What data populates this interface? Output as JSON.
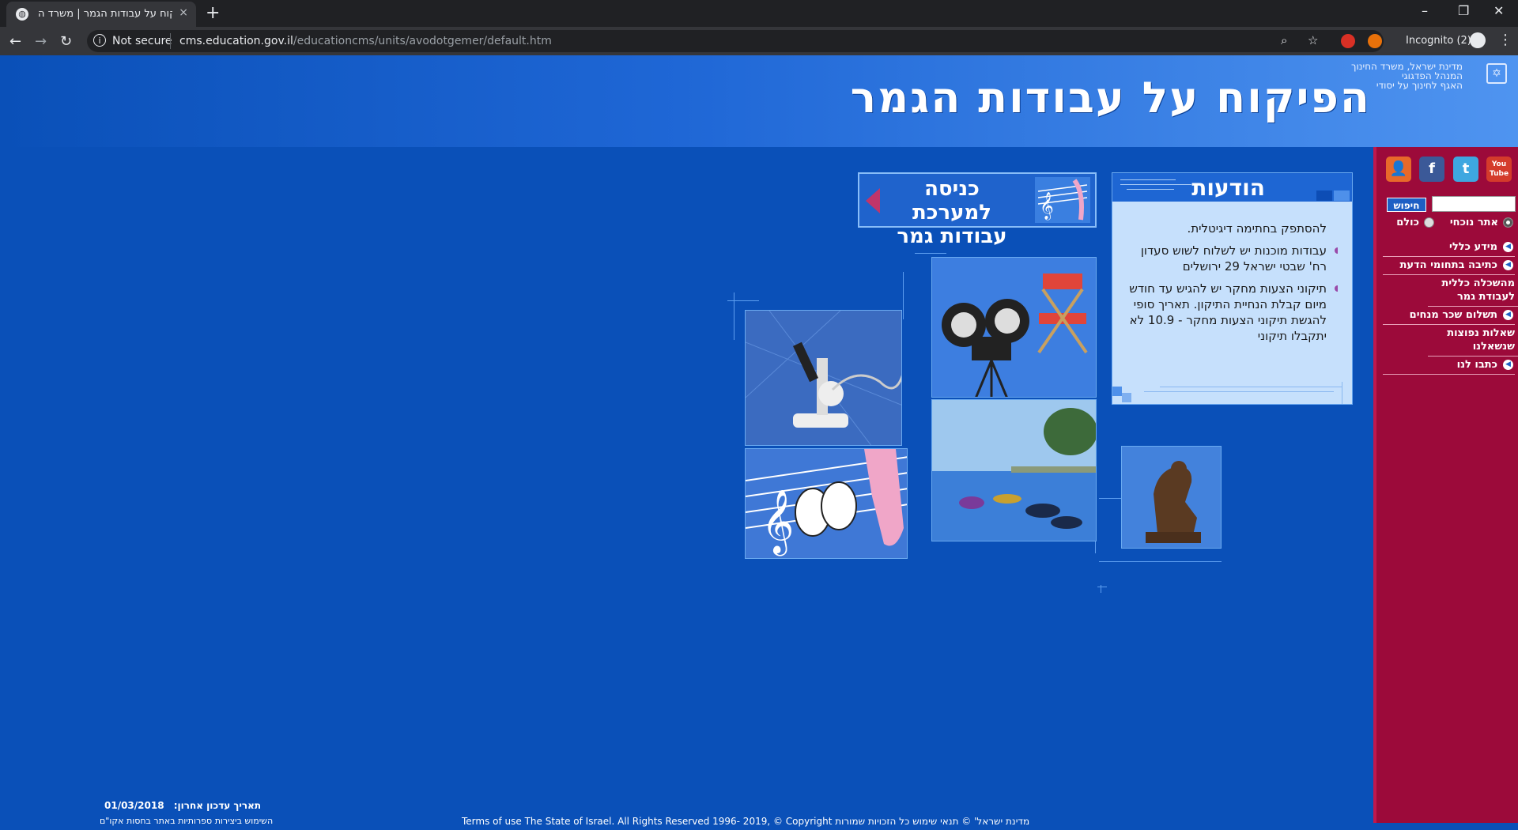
{
  "browser": {
    "tab_title": "הפיקוח על עבודות הגמר | משרד ה",
    "tab_close": "×",
    "new_tab": "+",
    "security": "Not secure",
    "url_host": "cms.education.gov.il",
    "url_path": "/educationcms/units/avodotgemer/default.htm",
    "incognito": "Incognito (2)",
    "win_min": "–",
    "win_max": "❐",
    "win_close": "✕"
  },
  "header": {
    "ministry_line1": "מדינת ישראל, משרד החינוך",
    "ministry_line2": "המנהל הפדגוגי",
    "ministry_line3": "האגף לחינוך על יסודי",
    "title": "הפיקוח על עבודות הגמר"
  },
  "sidebar": {
    "search_button": "חיפוש",
    "radio_current": "אתר נוכחי",
    "radio_all": "כולם",
    "nav": [
      {
        "label": "מידע כללי"
      },
      {
        "label": "כתיבה בתחומי הדעת"
      },
      {
        "label": "מהשכלה כללית לעבודת גמר"
      },
      {
        "label": "תשלום שכר מנחים"
      },
      {
        "label": "שאלות נפוצות שנשאלנו"
      },
      {
        "label": "כתבו לנו"
      }
    ],
    "social": {
      "contact": "👤",
      "facebook": "f",
      "twitter": "t",
      "youtube": "You Tube"
    }
  },
  "notices": {
    "title": "הודעות",
    "intro": "להסתפק בחתימה דיגיטלית.",
    "items": [
      {
        "text": "עבודות מוכנות יש לשלוח לשוש סעדון רח' שבטי ישראל 29 ירושלים"
      },
      {
        "text": "תיקוני הצעות מחקר יש להגיש עד חודש מיום קבלת הנחיית התיקון. תאריך סופי להגשת תיקוני הצעות מחקר - 10.9 לא יתקבלו תיקוני"
      }
    ]
  },
  "enter_banner": {
    "label": "כניסה למערכת עבודות גמר"
  },
  "footer": {
    "update_label": "תאריך עדכון אחרון:",
    "update_date": "01/03/2018",
    "note": "השימוש ביצירות ספרותיות באתר בחסות אקו\"ם",
    "copyright": "Terms of use The State of Israel. All Rights Reserved 1996- 2019, © Copyright מדינת ישראל' © תנאי שימוש כל הזכויות שמורות"
  },
  "colors": {
    "page_bg": "#0a50b8",
    "sidebar_bg": "#9c0a3a",
    "notices_bg": "#c6e0fc"
  }
}
